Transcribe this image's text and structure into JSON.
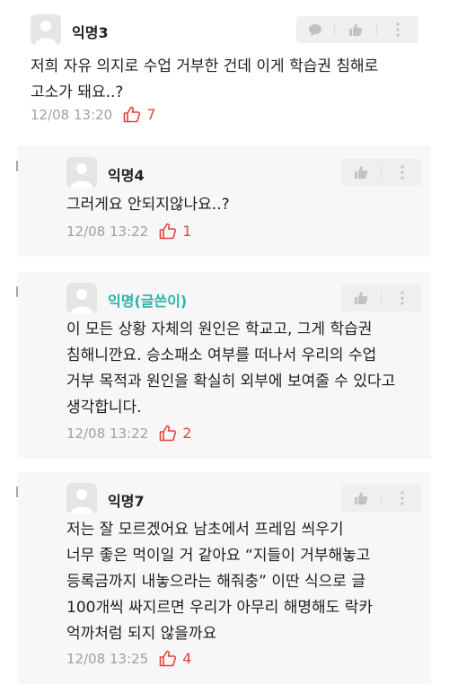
{
  "comments": [
    {
      "author": "익명3",
      "lines": [
        "저희 자유 의지로 수업 거부한 건데 이게 학습권 침해로",
        "고소가 돼요..?"
      ],
      "time": "12/08 13:20",
      "votes": "7",
      "is_reply": false,
      "is_op": false
    },
    {
      "author": "익명4",
      "lines": [
        "그러게요 안되지않나요..?"
      ],
      "time": "12/08 13:22",
      "votes": "1",
      "is_reply": true,
      "is_op": false
    },
    {
      "author": "익명(글쓴이)",
      "lines": [
        "이 모든 상황 자체의 원인은 학교고, 그게 학습권",
        "침해니깐요. 승소패소 여부를 떠나서 우리의 수업",
        "거부 목적과 원인을 확실히 외부에 보여줄 수 있다고",
        "생각합니다."
      ],
      "time": "12/08 13:22",
      "votes": "2",
      "is_reply": true,
      "is_op": true
    },
    {
      "author": "익명7",
      "lines": [
        "저는 잘 모르겠어요 남초에서 프레임 씌우기",
        "너무 좋은 먹이일 거 같아요 “지들이 거부해놓고",
        "등록금까지 내놓으라는 해줘충” 이딴 식으로 글",
        "100개씩 싸지르면 우리가 아무리 해명해도 락카",
        "억까처럼 되지 않을까요"
      ],
      "time": "12/08 13:25",
      "votes": "4",
      "is_reply": true,
      "is_op": false
    }
  ],
  "icons": {
    "avatar": "default-user-avatar-icon",
    "comment": "speech-bubble-icon",
    "like": "thumbs-up-icon",
    "more": "more-dots-icon",
    "reply_arrow": "reply-arrow-icon",
    "vote": "thumbs-up-outline-icon"
  },
  "colors": {
    "op_author": "#2bb3a8",
    "vote": "#e0443b",
    "timestamp": "#a0a0a0",
    "reply_background": "#f7f7f7"
  }
}
